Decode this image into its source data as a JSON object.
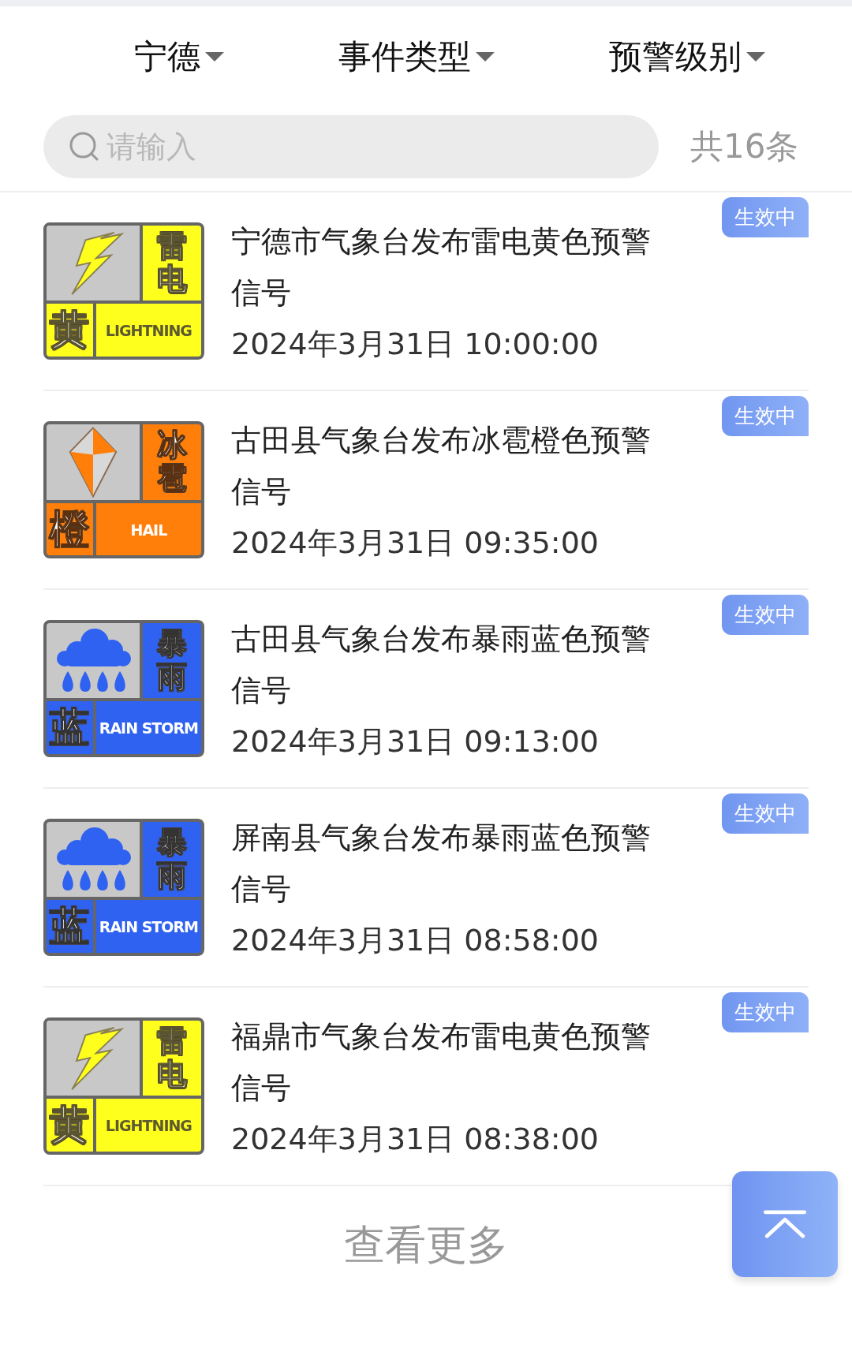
{
  "filters": [
    {
      "label": "宁德"
    },
    {
      "label": "事件类型"
    },
    {
      "label": "预警级别"
    }
  ],
  "search": {
    "placeholder": "请输入"
  },
  "count": "共16条",
  "alerts": [
    {
      "title": "宁德市气象台发布雷电黄色预警信号",
      "time": "2024年3月31日 10:00:00",
      "status": "生效中",
      "sign": {
        "kind": "lightning",
        "hazard": "雷电",
        "level": "黄",
        "english": "LIGHTNING",
        "color": "#ffff1e"
      }
    },
    {
      "title": "古田县气象台发布冰雹橙色预警信号",
      "time": "2024年3月31日 09:35:00",
      "status": "生效中",
      "sign": {
        "kind": "hail",
        "hazard": "冰雹",
        "level": "橙",
        "english": "HAIL",
        "color": "#ff7f0a"
      }
    },
    {
      "title": "古田县气象台发布暴雨蓝色预警信号",
      "time": "2024年3月31日 09:13:00",
      "status": "生效中",
      "sign": {
        "kind": "rainstorm",
        "hazard": "暴雨",
        "level": "蓝",
        "english": "RAIN STORM",
        "color": "#2f62f0"
      }
    },
    {
      "title": "屏南县气象台发布暴雨蓝色预警信号",
      "time": "2024年3月31日 08:58:00",
      "status": "生效中",
      "sign": {
        "kind": "rainstorm",
        "hazard": "暴雨",
        "level": "蓝",
        "english": "RAIN STORM",
        "color": "#2f62f0"
      }
    },
    {
      "title": "福鼎市气象台发布雷电黄色预警信号",
      "time": "2024年3月31日 08:38:00",
      "status": "生效中",
      "sign": {
        "kind": "lightning",
        "hazard": "雷电",
        "level": "黄",
        "english": "LIGHTNING",
        "color": "#ffff1e"
      }
    }
  ],
  "more": "查看更多"
}
